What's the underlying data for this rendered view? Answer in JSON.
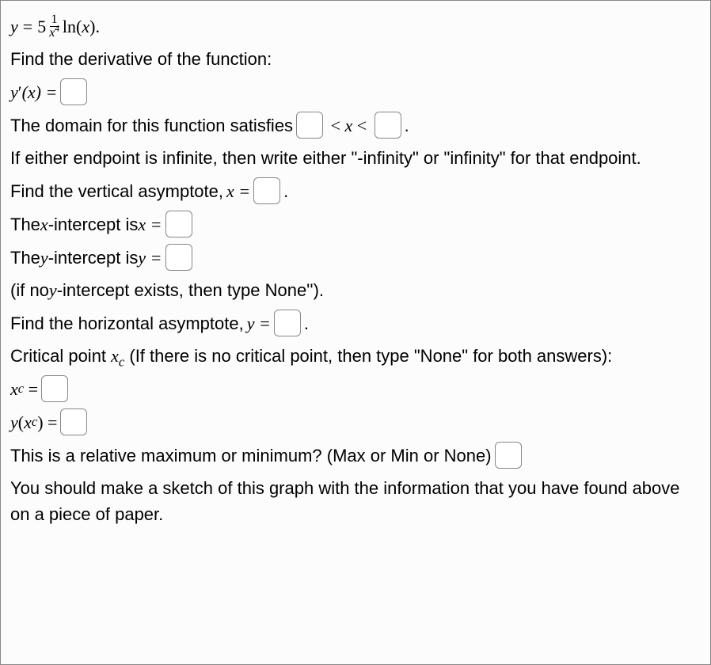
{
  "equation": {
    "lhs": "y",
    "eq": "=",
    "coef": "5",
    "frac_num": "1",
    "frac_den_base": "x",
    "frac_den_exp": "4",
    "func": "ln",
    "arg": "(x)",
    "period": "."
  },
  "prompts": {
    "find_derivative": "Find the derivative of the function:",
    "derivative_lhs": "y′(x) =",
    "domain_text": "The domain for this function satisfies ",
    "lt1": " < ",
    "domain_var": "x",
    "lt2": " < ",
    "domain_period": ".",
    "infinite_note": "If either endpoint is infinite, then write either \"-infinity\" or \"infinity\" for that endpoint.",
    "vertical_asymptote": "Find the vertical asymptote, ",
    "va_var": "x = ",
    "va_period": ".",
    "x_intercept": "The ",
    "x_int_var": "x",
    "x_int_text": "-intercept is ",
    "x_int_eq": "x = ",
    "y_intercept": "The ",
    "y_int_var": "y",
    "y_int_text": "-intercept is ",
    "y_int_eq": "y = ",
    "no_y_note": "(if no ",
    "no_y_var": "y",
    "no_y_text": "-intercept exists, then type None'').",
    "horizontal_asymptote": "Find the horizontal asymptote, ",
    "ha_var": "y = ",
    "ha_period": ".",
    "critical_point": "Critical point ",
    "cp_var": "x",
    "cp_sub": "c",
    "cp_text": " (If there is no critical point, then type \"None\" for both answers):",
    "xc_eq_base": "x",
    "xc_eq_sub": "c",
    "xc_eq": " = ",
    "yxc_eq_y": "y",
    "yxc_eq_open": "(",
    "yxc_eq_x": "x",
    "yxc_eq_sub": "c",
    "yxc_eq_close": ") = ",
    "max_min": "This is a relative maximum or minimum? (Max or Min or None) ",
    "sketch_note": "You should make a sketch of this graph with the information that you have found above on a piece of paper."
  }
}
